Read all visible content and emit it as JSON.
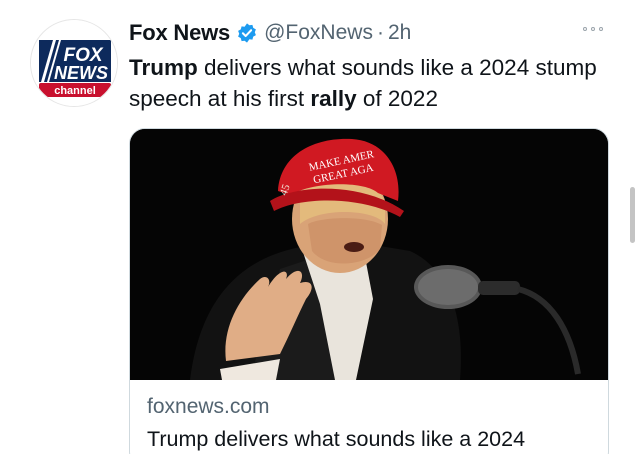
{
  "account": {
    "display_name": "Fox News",
    "handle": "@FoxNews",
    "separator": "·",
    "time": "2h",
    "verified_icon": "verified-badge-icon",
    "avatar_logo": {
      "line1": "FOX",
      "line2": "NEWS",
      "line3": "channel"
    }
  },
  "tweet": {
    "text_parts": [
      {
        "bold": true,
        "text": "Trump"
      },
      {
        "bold": false,
        "text": " delivers what sounds like a 2024 stump speech at his first "
      },
      {
        "bold": true,
        "text": "rally"
      },
      {
        "bold": false,
        "text": " of 2022"
      }
    ]
  },
  "card": {
    "domain": "foxnews.com",
    "title": "Trump delivers what sounds like a 2024",
    "photo_description_icon": "news-photo",
    "hat_text": {
      "line1": "MAKE AMER",
      "line2": "GREAT AGA",
      "side": "45"
    }
  },
  "menu": {
    "icon": "more-options-icon"
  },
  "colors": {
    "accent": "#1d9bf0",
    "muted": "#536471",
    "text": "#0f1419",
    "fox_blue": "#0d2a5c",
    "fox_red": "#c8102e"
  }
}
